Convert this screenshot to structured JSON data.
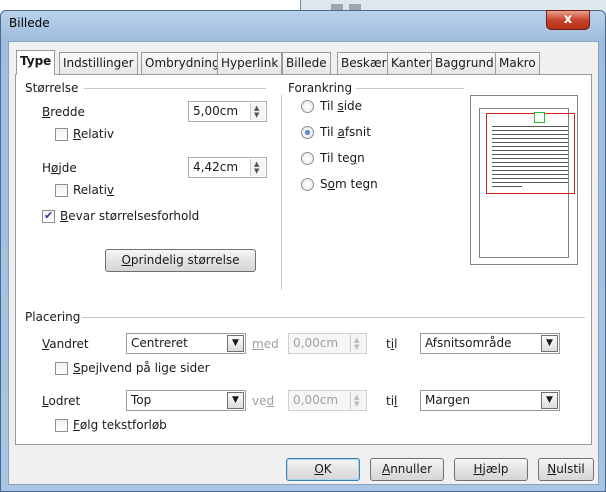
{
  "window": {
    "title": "Billede",
    "close_glyph": "x"
  },
  "tabs": [
    "Type",
    "Indstillinger",
    "Ombrydning",
    "Hyperlink",
    "Billede",
    "Beskær",
    "Kanter",
    "Baggrund",
    "Makro"
  ],
  "size": {
    "group_label": "Størrelse",
    "width_label": "Bredde",
    "width_value": "5,00cm",
    "width_relative_label": "Relativ",
    "height_label": "Højde",
    "height_value": "4,42cm",
    "height_relative_label": "Relativ",
    "keep_ratio_label": "Bevar størrelsesforhold",
    "original_size_button": "Oprindelig størrelse"
  },
  "anchor": {
    "group_label": "Forankring",
    "options": [
      "Til side",
      "Til afsnit",
      "Til tegn",
      "Som tegn"
    ],
    "selected": "Til afsnit"
  },
  "position": {
    "group_label": "Placering",
    "horizontal_label": "Vandret",
    "horizontal_value": "Centreret",
    "horizontal_by_label": "med",
    "horizontal_by_value": "0,00cm",
    "horizontal_to_label": "til",
    "horizontal_to_value": "Afsnitsområde",
    "mirror_label": "Spejlvend på lige sider",
    "vertical_label": "Lodret",
    "vertical_value": "Top",
    "vertical_by_label": "ved",
    "vertical_by_value": "0,00cm",
    "vertical_to_label": "til",
    "vertical_to_value": "Margen",
    "follow_flow_label": "Følg tekstforløb"
  },
  "footer": {
    "ok": "OK",
    "cancel": "Annuller",
    "help": "Hjælp",
    "reset": "Nulstil"
  },
  "icons": {
    "close": "close-icon",
    "dropdown": "chevron-down-icon",
    "spin": "spin-arrows-icon"
  }
}
